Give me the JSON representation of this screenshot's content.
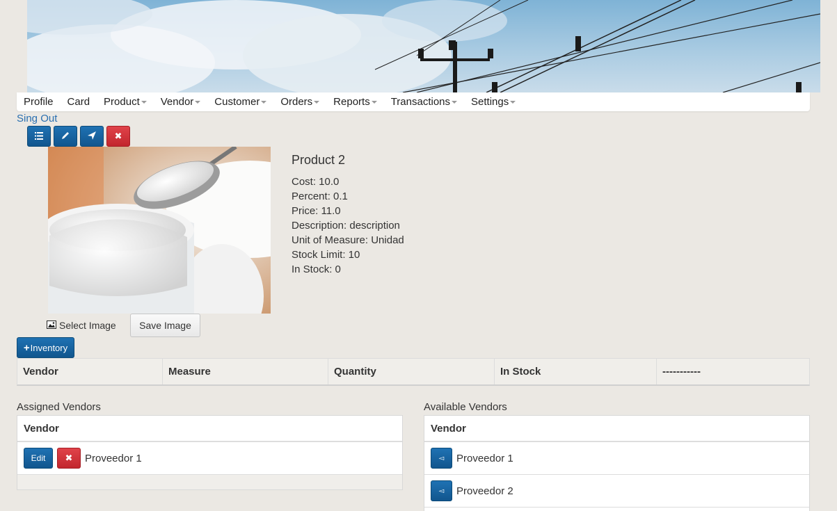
{
  "nav": {
    "items": [
      {
        "label": "Profile",
        "dropdown": false
      },
      {
        "label": "Card",
        "dropdown": false
      },
      {
        "label": "Product",
        "dropdown": true
      },
      {
        "label": "Vendor",
        "dropdown": true
      },
      {
        "label": "Customer",
        "dropdown": true
      },
      {
        "label": "Orders",
        "dropdown": true
      },
      {
        "label": "Reports",
        "dropdown": true
      },
      {
        "label": "Transactions",
        "dropdown": true
      },
      {
        "label": "Settings",
        "dropdown": true
      }
    ],
    "signout": "Sing Out"
  },
  "toolbar": {
    "icons": [
      "list-icon",
      "pencil-icon",
      "send-icon",
      "close-icon"
    ]
  },
  "product": {
    "title": "Product 2",
    "cost": "Cost: 10.0",
    "percent": "Percent: 0.1",
    "price": "Price: 11.0",
    "description": "Description: description",
    "unit": "Unit of Measure: Unidad",
    "stock_limit": "Stock Limit: 10",
    "in_stock": "In Stock: 0"
  },
  "image_controls": {
    "select_label": "Select Image",
    "save_label": "Save Image"
  },
  "inventory": {
    "button_label": "Inventory",
    "columns": [
      "Vendor",
      "Measure",
      "Quantity",
      "In Stock",
      "-----------"
    ]
  },
  "assigned": {
    "label": "Assigned Vendors",
    "header": "Vendor",
    "edit_label": "Edit",
    "rows": [
      "Proveedor 1"
    ]
  },
  "available": {
    "label": "Available Vendors",
    "header": "Vendor",
    "rows": [
      "Proveedor 1",
      "Proveedor 2"
    ]
  },
  "colors": {
    "primary": "#11568e",
    "danger": "#c2262d",
    "background": "#ebe8e3",
    "link": "#2a6fb0"
  }
}
